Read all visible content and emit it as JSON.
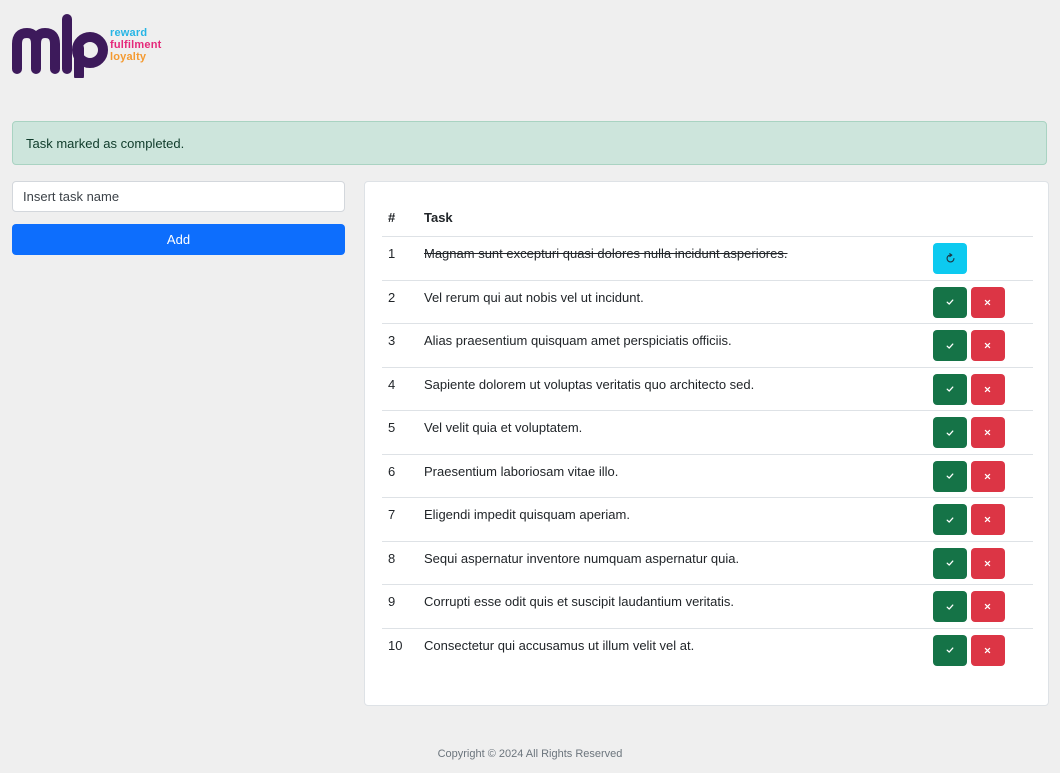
{
  "logo": {
    "brand": "mlp",
    "taglines": [
      "reward",
      "fulfilment",
      "loyalty"
    ],
    "colors": {
      "brand": "#3d1a5b",
      "reward": "#27b5e5",
      "fulfilment": "#e5297a",
      "loyalty": "#f49a31"
    }
  },
  "alert": {
    "message": "Task marked as completed."
  },
  "form": {
    "placeholder": "Insert task name",
    "add_label": "Add"
  },
  "table": {
    "headers": {
      "num": "#",
      "task": "Task"
    },
    "rows": [
      {
        "num": "1",
        "task": "Magnam sunt excepturi quasi dolores nulla incidunt asperiores.",
        "completed": true
      },
      {
        "num": "2",
        "task": "Vel rerum qui aut nobis vel ut incidunt.",
        "completed": false
      },
      {
        "num": "3",
        "task": "Alias praesentium quisquam amet perspiciatis officiis.",
        "completed": false
      },
      {
        "num": "4",
        "task": "Sapiente dolorem ut voluptas veritatis quo architecto sed.",
        "completed": false
      },
      {
        "num": "5",
        "task": "Vel velit quia et voluptatem.",
        "completed": false
      },
      {
        "num": "6",
        "task": "Praesentium laboriosam vitae illo.",
        "completed": false
      },
      {
        "num": "7",
        "task": "Eligendi impedit quisquam aperiam.",
        "completed": false
      },
      {
        "num": "8",
        "task": "Sequi aspernatur inventore numquam aspernatur quia.",
        "completed": false
      },
      {
        "num": "9",
        "task": "Corrupti esse odit quis et suscipit laudantium veritatis.",
        "completed": false
      },
      {
        "num": "10",
        "task": "Consectetur qui accusamus ut illum velit vel at.",
        "completed": false
      }
    ]
  },
  "icons": {
    "complete": "check-icon",
    "delete": "close-icon",
    "undo": "refresh-icon"
  },
  "footer": {
    "text": "Copyright © 2024 All Rights Reserved"
  }
}
